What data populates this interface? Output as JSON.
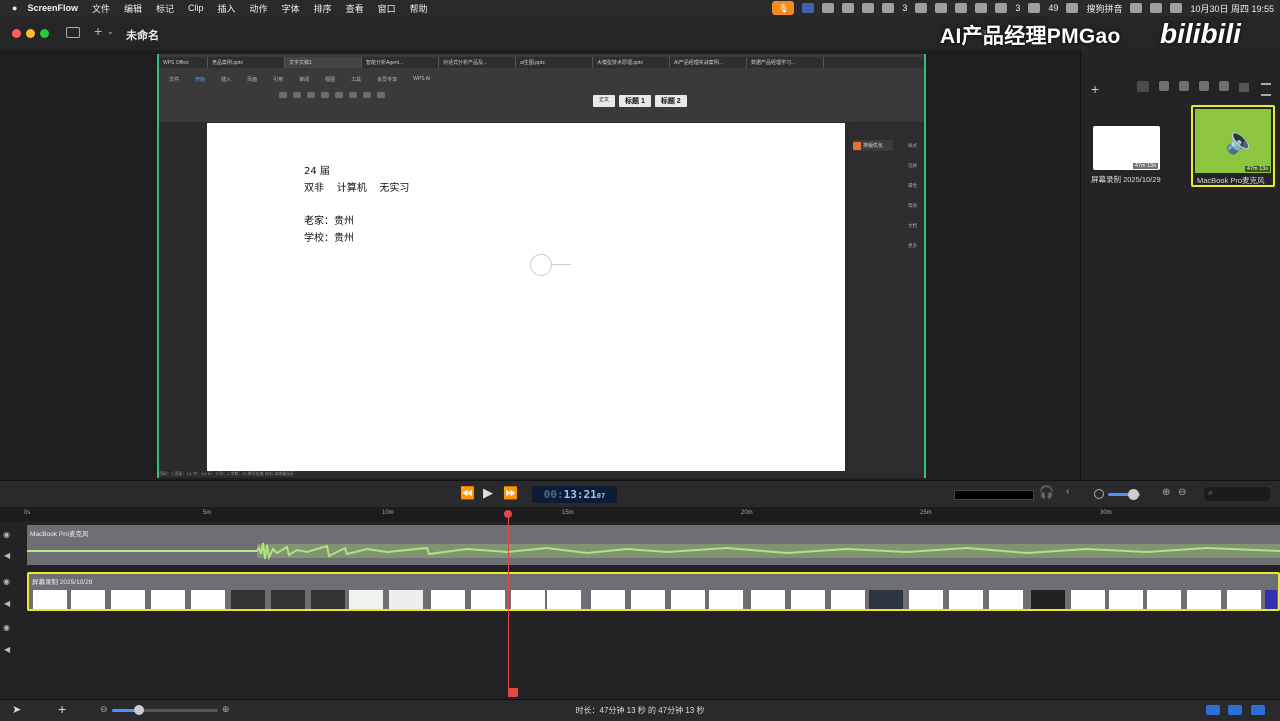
{
  "menubar": {
    "apple": "",
    "app_name": "ScreenFlow",
    "items": [
      "文件",
      "编辑",
      "标记",
      "Clip",
      "插入",
      "动作",
      "字体",
      "排序",
      "查看",
      "窗口",
      "帮助"
    ],
    "status_wechat_count": "3",
    "status_msg_count": "49",
    "status_notif_count": "3",
    "status_input": "搜狗拼音",
    "status_datetime": "10月30日 周四  19:55"
  },
  "window": {
    "title": "未命名",
    "zoom": "30%"
  },
  "watermark": {
    "text": "AI产品经理PMGao",
    "logo": "bilibili"
  },
  "wps": {
    "tabs": [
      "WPS Office",
      "竞品案例.pptx",
      "文字文稿1",
      "智能分析Agent...",
      "对话式分析产品及...",
      "ai生图.pptx",
      "大模型技术原理.pptx",
      "AI产品经理实战案例...",
      "数据产品经理学习..."
    ],
    "ribbon": [
      "文件",
      "开始",
      "插入",
      "页面",
      "引用",
      "审阅",
      "视图",
      "工具",
      "会员专享",
      "WPS AI"
    ],
    "styles": [
      "正文",
      "标题 1",
      "标题 2"
    ],
    "side_panel_btn": "排版优化",
    "right_tools": [
      "样式",
      "选择",
      "属性",
      "帮助",
      "文档",
      "更多"
    ],
    "status": "页码：1   页面：1/1   节：1/1   行：3   列：1   字数：20   拼写检查   校对   本地备份开"
  },
  "document": {
    "lines": [
      "24 届",
      "双非    计算机    无实习",
      "",
      "老家：贵州",
      "学校：贵州"
    ]
  },
  "media_library": {
    "items": [
      {
        "label": "屏幕录制 2025/10/29",
        "duration": "47m 13s"
      },
      {
        "label": "MacBook Pro麦克风",
        "duration": "47m 13s"
      }
    ]
  },
  "transport": {
    "timecode_hours": "00:",
    "timecode_main": "13:21",
    "timecode_frames": "07"
  },
  "ruler": {
    "ticks": [
      "0s",
      "5m",
      "10m",
      "15m",
      "20m",
      "25m",
      "30m"
    ]
  },
  "tracks": {
    "audio_clip": "MacBook Pro麦克风",
    "video_clip": "屏幕录制 2025/10/29"
  },
  "footer": {
    "duration": "时长：47分钟 13 秒 的 47分钟 13 秒"
  },
  "colors": {
    "accent_green": "#2ec27e",
    "selection_yellow": "#e9eb2a",
    "playhead_red": "#e24747",
    "audio_thumb_green": "#8cc63f"
  }
}
